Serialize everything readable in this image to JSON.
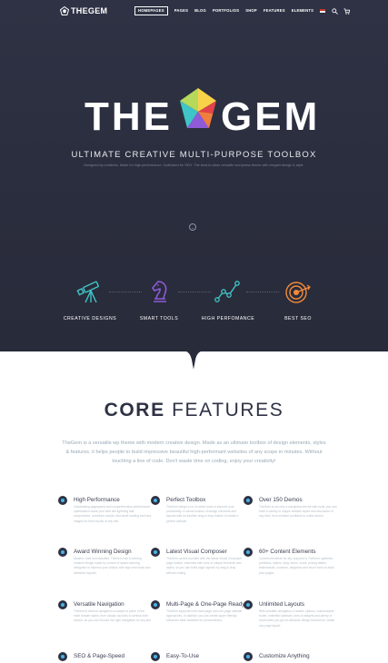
{
  "header": {
    "logo_text": "THEGEM",
    "nav": [
      {
        "label": "HOMEPAGES",
        "active": true
      },
      {
        "label": "PAGES",
        "active": false
      },
      {
        "label": "BLOG",
        "active": false
      },
      {
        "label": "PORTFOLIOS",
        "active": false
      },
      {
        "label": "SHOP",
        "active": false
      },
      {
        "label": "FEATURES",
        "active": false
      },
      {
        "label": "ELEMENTS",
        "active": false
      }
    ],
    "icons": [
      "flag-icon",
      "search-icon",
      "cart-icon"
    ]
  },
  "hero": {
    "logo_left": "THE",
    "logo_right": "GEM",
    "tagline": "ULTIMATE CREATIVE MULTI-PURPOSE TOOLBOX",
    "subline": "Designed by creatives. Made for high performance. Optimized for SEO. The best-in-class versatile wordpress theme with elegant design & style.",
    "features": [
      {
        "label": "CREATIVE DESIGNS",
        "icon": "telescope-icon"
      },
      {
        "label": "SMART TOOLS",
        "icon": "chess-knight-icon"
      },
      {
        "label": "HIGH PERFOMANCE",
        "icon": "line-graph-icon"
      },
      {
        "label": "BEST SEO",
        "icon": "target-icon"
      }
    ]
  },
  "core": {
    "title_bold": "CORE",
    "title_light": "FEATURES",
    "description": "TheGem is a versatile wp theme with modern creative design. Made as an ultimate toolbox of design elements, styles & features, it helps people to build impressive beautiful high-performant websites of any scope in minutes. Without touching a line of code. Don't waste time on coding, enjoy your creativity!",
    "items": [
      {
        "title": "High Performance",
        "text": "Outstanding pagespeed and comprehensive performance optimization make your web site lightning fast: compressed, combined scripts, fast asset loading and lazy images for best results of any site."
      },
      {
        "title": "Perfect Toolbox",
        "text": "TheGem brings a lot of useful tools to improve your productivity: a robust toolbox of design elements and layouts with an intuitive drag & drop builder to create a perfect website."
      },
      {
        "title": "Over 150 Demos",
        "text": "TheGem is not only a wordpress theme with tools, you can build a variety of unique website styles and structures of any kind, from creative portfolios to online stores."
      },
      {
        "title": "Award Winning Design",
        "text": "Modern, bold and beautiful: TheGem has a winning creative design made by a team of award-winning designers to impress your visitors with high-end looks and attractive layouts."
      },
      {
        "title": "Latest Visual Composer",
        "text": "TheGem comes bundled with the latest Visual Composer page builder, extended with tons of unique elements and styles, so you can build page layouts by drag & drop, without coding."
      },
      {
        "title": "60+ Content Elements",
        "text": "Content elements for any purpose in TheGem: galleries, portfolios, sliders, blog, forms, icons, pricing tables, testimonials, counters, diagrams and much more to build your pages."
      },
      {
        "title": "Versatile Navigation",
        "text": "TheGem's diverse navigation concepts in place of the main header styles, from classic top bars to vertical side menus, so you can choose the right navigation for any site."
      },
      {
        "title": "Multi-Page & One-Page Ready",
        "text": "TheGem supports both multi-page and one-page website approaches. In addition you can create super friendly fullscreen slide websites for presentations."
      },
      {
        "title": "Unlimited Layouts",
        "text": "With versatile navigation & header options, customizable footer, unlimited sidebars, tons of widgets and plenty of shortcodes you get an absolute design freedom to create any page layout."
      },
      {
        "title": "SEO & Page-Speed",
        "text": ""
      },
      {
        "title": "Easy-To-Use",
        "text": ""
      },
      {
        "title": "Customize Anything",
        "text": ""
      }
    ]
  },
  "colors": {
    "hero_bg": "#2a2d3d",
    "accent_teal": "#3fc5c7",
    "accent_purple": "#8e5bd8",
    "accent_orange": "#f28a3a",
    "accent_blue": "#46b3e6"
  }
}
